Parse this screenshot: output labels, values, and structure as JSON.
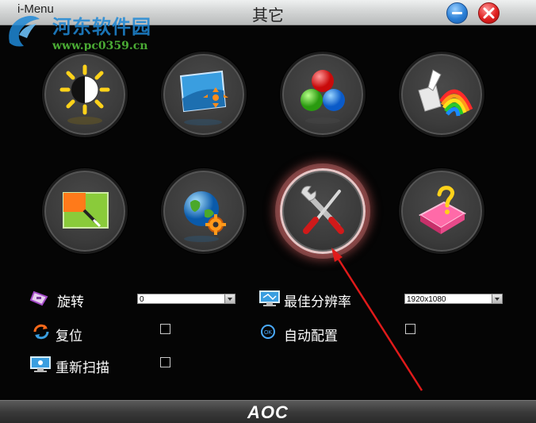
{
  "titlebar": {
    "app_name": "i-Menu",
    "title": "其它"
  },
  "watermark": {
    "site_name": "河东软件园",
    "url": "www.pc0359.cn"
  },
  "icons": [
    {
      "name": "brightness-icon"
    },
    {
      "name": "picture-position-icon"
    },
    {
      "name": "color-icon"
    },
    {
      "name": "color-boost-icon"
    },
    {
      "name": "picture-boost-icon"
    },
    {
      "name": "osd-settings-icon"
    },
    {
      "name": "extra-tools-icon",
      "selected": true
    },
    {
      "name": "exit-icon"
    }
  ],
  "settings": {
    "rotation": {
      "label": "旋转",
      "value": "0"
    },
    "best_resolution": {
      "label": "最佳分辨率",
      "value": "1920x1080"
    },
    "reset": {
      "label": "复位",
      "checked": false
    },
    "auto_config": {
      "label": "自动配置",
      "checked": false
    },
    "rescan": {
      "label": "重新扫描",
      "checked": false
    }
  },
  "footer": {
    "brand": "AOC"
  },
  "colors": {
    "accent_arrow": "#e01a1a",
    "selected_glow": "#d88a8a",
    "title_bar": "#d4d6d6"
  }
}
